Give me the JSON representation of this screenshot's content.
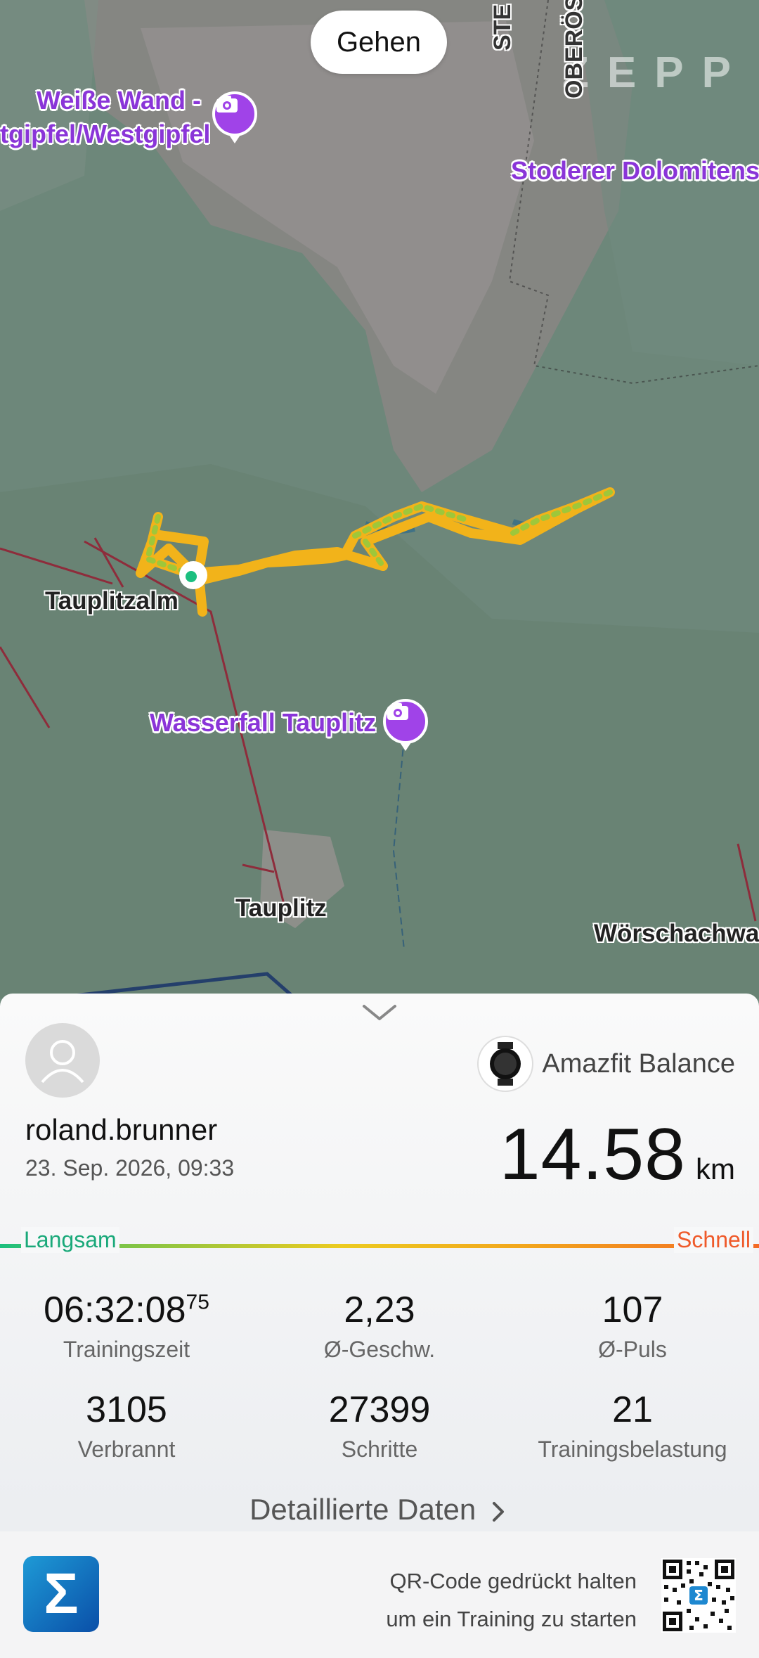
{
  "map": {
    "activity_type": "Gehen",
    "brand": "ZEPP",
    "places": {
      "weisse_wand_line1": "Weiße Wand -",
      "weisse_wand_line2": "tgipfel/Westgipfel",
      "stoderer": "Stoderer Dolomitenst",
      "tauplitzalm": "Tauplitzalm",
      "wasserfall": "Wasserfall Tauplitz",
      "tauplitz": "Tauplitz",
      "woerschach": "Wörschachwa",
      "road_ste": "STE",
      "road_oberoes": "OBERÖS"
    }
  },
  "sheet": {
    "username": "roland.brunner",
    "datetime": "23. Sep. 2026, 09:33",
    "device": "Amazfit Balance",
    "distance": "14.58",
    "distance_unit": "km",
    "slow_label": "Langsam",
    "fast_label": "Schnell",
    "stats": [
      {
        "value": "06:32:08",
        "sup": "75",
        "label": "Trainingszeit"
      },
      {
        "value": "2,23",
        "label": "Ø-Geschw."
      },
      {
        "value": "107",
        "label": "Ø-Puls"
      },
      {
        "value": "3105",
        "label": "Verbrannt"
      },
      {
        "value": "27399",
        "label": "Schritte"
      },
      {
        "value": "21",
        "label": "Trainingsbelastung"
      }
    ],
    "detail_link": "Detaillierte Daten"
  },
  "footer": {
    "logo_glyph": "Σ",
    "qr_line1": "QR-Code gedrückt halten",
    "qr_line2": "um ein Training zu starten"
  }
}
